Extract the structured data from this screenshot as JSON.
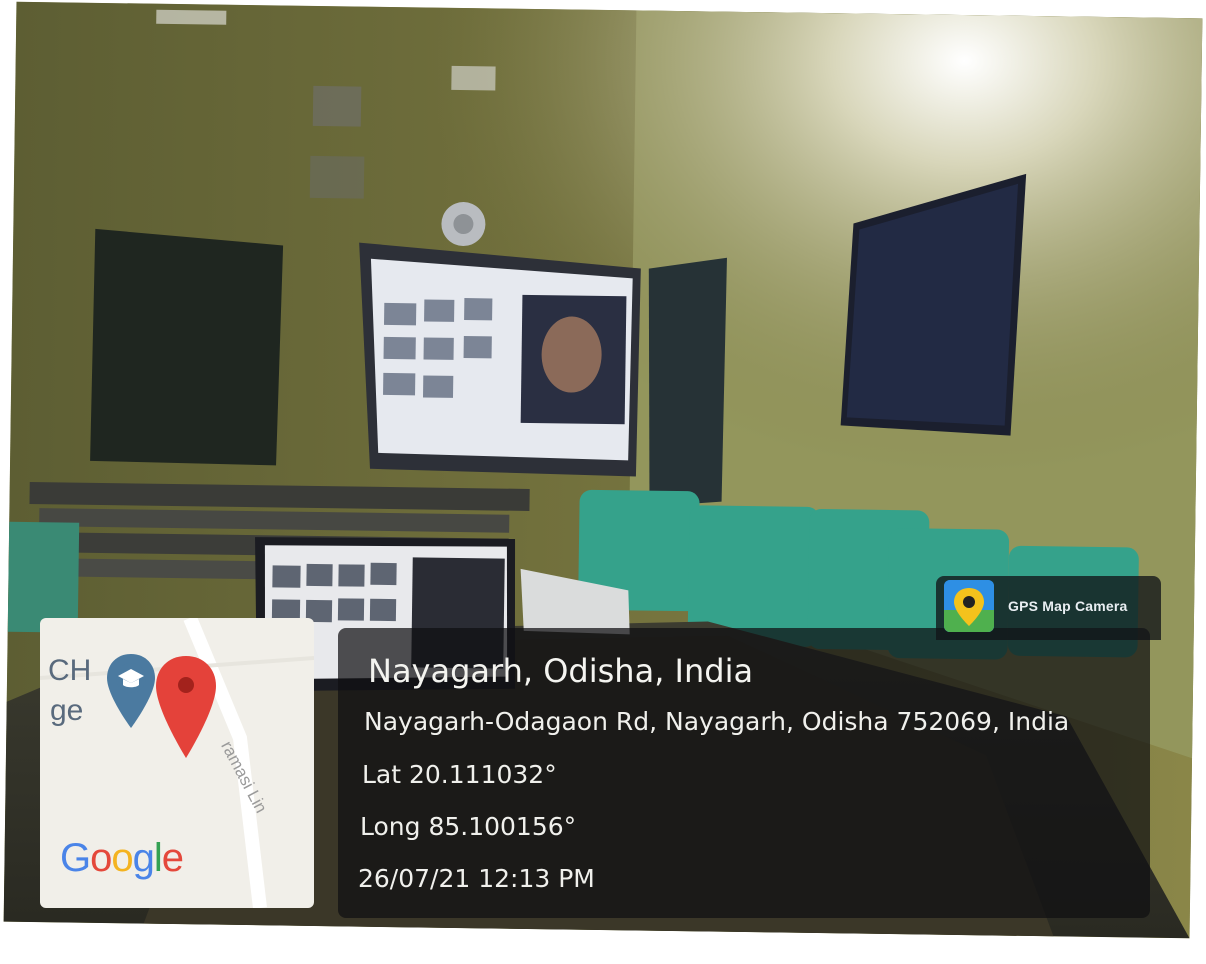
{
  "photo": {
    "subject": "classroom-with-projector"
  },
  "overlay": {
    "app_name": "GPS Map Camera",
    "location_title": "Nayagarh, Odisha, India",
    "address": "Nayagarh-Odagaon Rd, Nayagarh, Odisha 752069, India",
    "latitude": "Lat 20.111032°",
    "longitude": "Long 85.100156°",
    "datetime": "26/07/21 12:13 PM"
  },
  "minimap": {
    "label_partial_1": "CH",
    "label_partial_2": "ge",
    "road_name": "ramasi Lin",
    "google_logo": [
      "G",
      "o",
      "o",
      "g",
      "l",
      "e"
    ],
    "google_colors": [
      "#4a84e8",
      "#e4483b",
      "#f4b320",
      "#4a84e8",
      "#34a153",
      "#e4483b"
    ]
  }
}
